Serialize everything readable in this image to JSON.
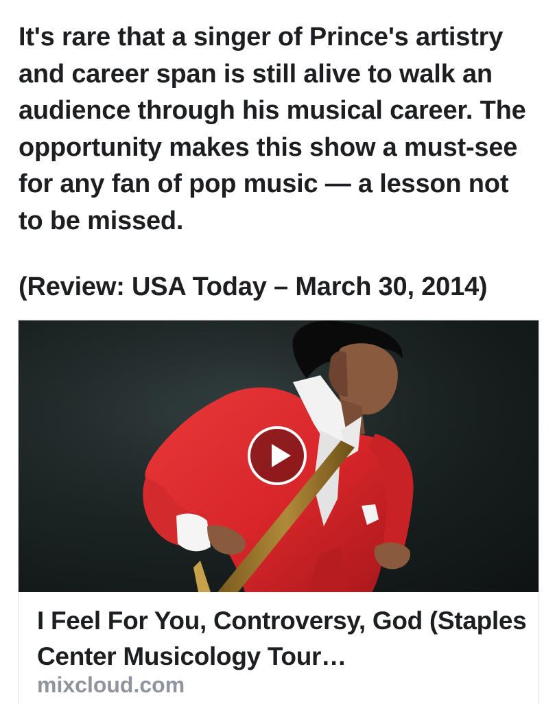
{
  "post": {
    "text": "It's rare that a singer of Prince's artistry and career span is still alive to walk an audience through his musical career. The opportunity makes this show a must-see for any fan of pop music — a lesson not to be missed.",
    "credit": "(Review: USA Today – March 30, 2014)"
  },
  "link_card": {
    "title": "I Feel For You, Controversy, God (Staples Center Musicology Tour…",
    "domain": "mixcloud.com",
    "preview_icon": "play-icon"
  },
  "colors": {
    "text": "#1c1e21",
    "domain": "#90949c",
    "card_border": "#dddfe2",
    "jacket_red": "#d8262a",
    "background_dark": "#141a1a"
  }
}
